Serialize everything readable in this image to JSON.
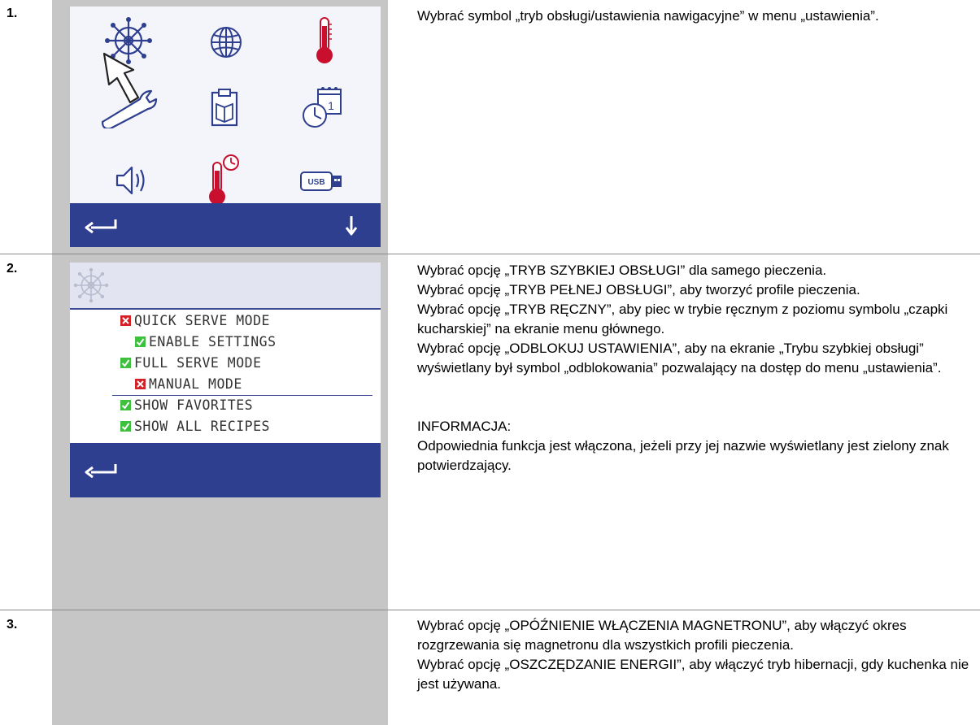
{
  "steps": [
    {
      "number": "1.",
      "paragraphs": [
        "Wybrać symbol „tryb obsługi/ustawienia nawigacyjne” w menu „ustawienia”."
      ]
    },
    {
      "number": "2.",
      "paragraphs": [
        "Wybrać opcję „TRYB SZYBKIEJ OBSŁUGI” dla samego pieczenia.",
        "Wybrać opcję „TRYB PEŁNEJ OBSŁUGI”, aby tworzyć profile pieczenia.",
        "Wybrać opcję „TRYB RĘCZNY”, aby piec w trybie ręcznym z poziomu symbolu „czapki kucharskiej” na ekranie menu głównego.",
        "Wybrać opcję „ODBLOKUJ USTAWIENIA”, aby na ekranie „Trybu szybkiej obsługi” wyświetlany był symbol „odblokowania” pozwalający na dostęp do menu „ustawienia”."
      ],
      "note_label": "INFORMACJA:",
      "note_text": "Odpowiednia funkcja jest włączona, jeżeli przy jej nazwie wyświetlany jest zielony znak potwierdzający."
    },
    {
      "number": "3.",
      "paragraphs": [
        "Wybrać opcję „OPÓŹNIENIE WŁĄCZENIA MAGNETRONU”, aby włączyć okres rozgrzewania się magnetronu dla wszystkich profili pieczenia.",
        "Wybrać opcję „OSZCZĘDZANIE ENERGII”, aby włączyć tryb hibernacji, gdy kuchenka nie jest używana."
      ]
    }
  ],
  "screen1": {
    "usb_label": "USB",
    "calendar_day": "1",
    "icons": [
      "service-mode-wheel-icon",
      "globe-icon",
      "thermometer-icon",
      "wrench-icon",
      "recipe-book-icon",
      "clock-calendar-icon",
      "speaker-icon",
      "thermometer-clock-icon",
      "usb-icon",
      "back-arrow-icon",
      "down-arrow-icon"
    ]
  },
  "screen2": {
    "options": [
      {
        "label": "QUICK SERVE MODE",
        "checked": false
      },
      {
        "label": "ENABLE SETTINGS",
        "checked": true
      },
      {
        "label": "FULL SERVE MODE",
        "checked": true
      },
      {
        "label": "MANUAL MODE",
        "checked": false
      },
      {
        "label": "SHOW FAVORITES",
        "checked": true
      },
      {
        "label": "SHOW ALL RECIPES",
        "checked": true
      }
    ]
  },
  "colors": {
    "bar_blue": "#2f3f8f",
    "icon_blue": "#2f3f8f",
    "thermo_red": "#c8102e",
    "check_green": "#3dc03d",
    "cross_red": "#d42127",
    "panel_gray": "#c6c6c6"
  }
}
